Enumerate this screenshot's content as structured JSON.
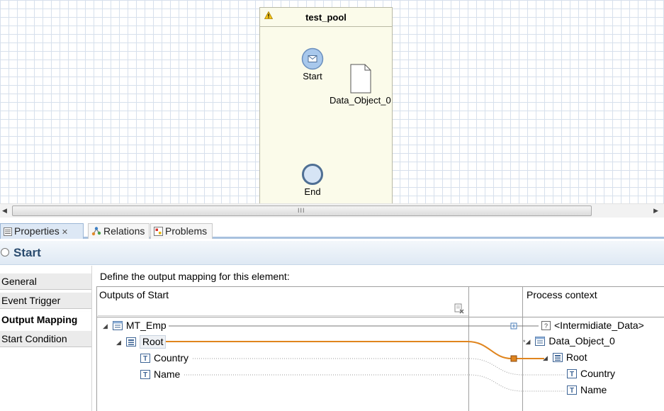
{
  "canvas": {
    "pool_title": "test_pool",
    "start_label": "Start",
    "data_object_label": "Data_Object_0",
    "end_label": "End"
  },
  "scrollbar": {
    "grip": "III"
  },
  "tabs": [
    {
      "label": "Properties",
      "icon": "properties-icon",
      "active": true
    },
    {
      "label": "Relations",
      "icon": "relations-icon",
      "active": false
    },
    {
      "label": "Problems",
      "icon": "problems-icon",
      "active": false
    }
  ],
  "properties": {
    "title": "Start",
    "nav": [
      "General",
      "Event Trigger",
      "Output Mapping",
      "Start Condition"
    ],
    "selected_nav": "Output Mapping"
  },
  "mapping": {
    "description": "Define the output mapping for this element:",
    "outputs_header": "Outputs of Start",
    "context_header": "Process context",
    "outputs_tree": [
      "MT_Emp",
      "Root",
      "Country",
      "Name"
    ],
    "context_tree": [
      "<Intermidiate_Data>",
      "Data_Object_0",
      "Root",
      "Country",
      "Name"
    ]
  },
  "colors": {
    "accent_blue": "#a7c1de",
    "mapping_line": "#e0851e",
    "pool_fill": "#fbfbea",
    "title_text": "#2a4b6e"
  }
}
